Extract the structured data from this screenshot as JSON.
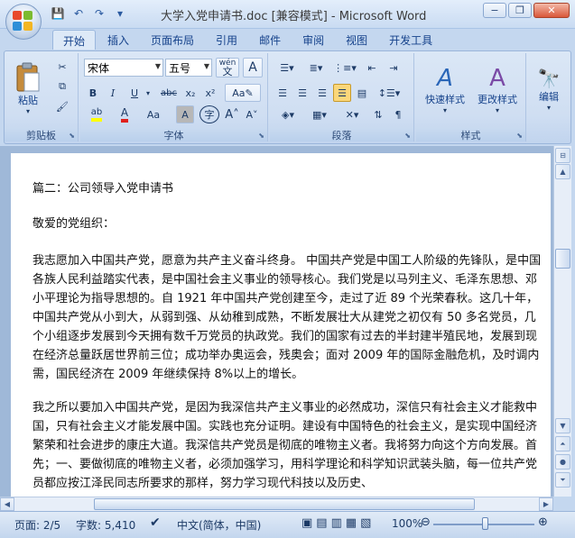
{
  "window": {
    "title": "大学入党申请书.doc [兼容模式] - Microsoft Word",
    "minimize": "−",
    "restore": "❐",
    "close": "✕"
  },
  "qat": {
    "save": "💾",
    "undo": "↶",
    "redo": "↷",
    "more": "▾"
  },
  "tabs": [
    {
      "label": "开始",
      "active": true
    },
    {
      "label": "插入"
    },
    {
      "label": "页面布局"
    },
    {
      "label": "引用"
    },
    {
      "label": "邮件"
    },
    {
      "label": "审阅"
    },
    {
      "label": "视图"
    },
    {
      "label": "开发工具"
    }
  ],
  "ribbon": {
    "clipboard": {
      "label": "剪贴板",
      "paste": "粘贴"
    },
    "font": {
      "label": "字体",
      "font_name": "宋体",
      "font_size": "五号",
      "wen_label": "wén",
      "bold": "B",
      "italic": "I",
      "underline": "U",
      "strike": "abc",
      "subscript": "x₂",
      "superscript": "x²",
      "grow": "A˄",
      "shrink": "A˅",
      "change_case": "Aa",
      "char_shading": "A",
      "enclose": "字",
      "clear": "A",
      "font_color": "A",
      "highlight": "ab"
    },
    "paragraph": {
      "label": "段落"
    },
    "styles": {
      "label": "样式",
      "quick_styles": "快速样式",
      "change_styles": "更改样式"
    },
    "editing": {
      "label": "编辑"
    }
  },
  "document": {
    "paragraphs": [
      "篇二：公司领导入党申请书",
      "敬爱的党组织：",
      "我志愿加入中国共产党，愿意为共产主义奋斗终身。 中国共产党是中国工人阶级的先锋队，是中国各族人民利益踏实代表，是中国社会主义事业的领导核心。我们党是以马列主义、毛泽东思想、邓小平理论为指导思想的。自 1921 年中国共产党创建至今，走过了近 89 个光荣春秋。这几十年，中国共产党从小到大，从弱到强、从幼稚到成熟，不断发展壮大从建党之初仅有 50 多名党员，几个小组逐步发展到今天拥有数千万党员的执政党。我们的国家有过去的半封建半殖民地，发展到现在经济总量跃居世界前三位；成功举办奥运会，残奥会；面对 2009 年的国际金融危机，及时调内需，国民经济在 2009 年继续保持 8%以上的增长。",
      "我之所以要加入中国共产党，是因为我深信共产主义事业的必然成功，深信只有社会主义才能救中国，只有社会主义才能发展中国。实践也充分证明。建设有中国特色的社会主义，是实现中国经济繁荣和社会进步的康庄大道。我深信共产党员是彻底的唯物主义者。我将努力向这个方向发展。首先；一、要做彻底的唯物主义者，必须加强学习，用科学理论和科学知识武装头脑，每一位共产党员都应按江泽民同志所要求的那样，努力学习现代科技以及历史、"
    ]
  },
  "status": {
    "page": "页面: 2/5",
    "words": "字数: 5,410",
    "language": "中文(简体，中国)",
    "zoom": "100%",
    "zoom_level": 100
  }
}
